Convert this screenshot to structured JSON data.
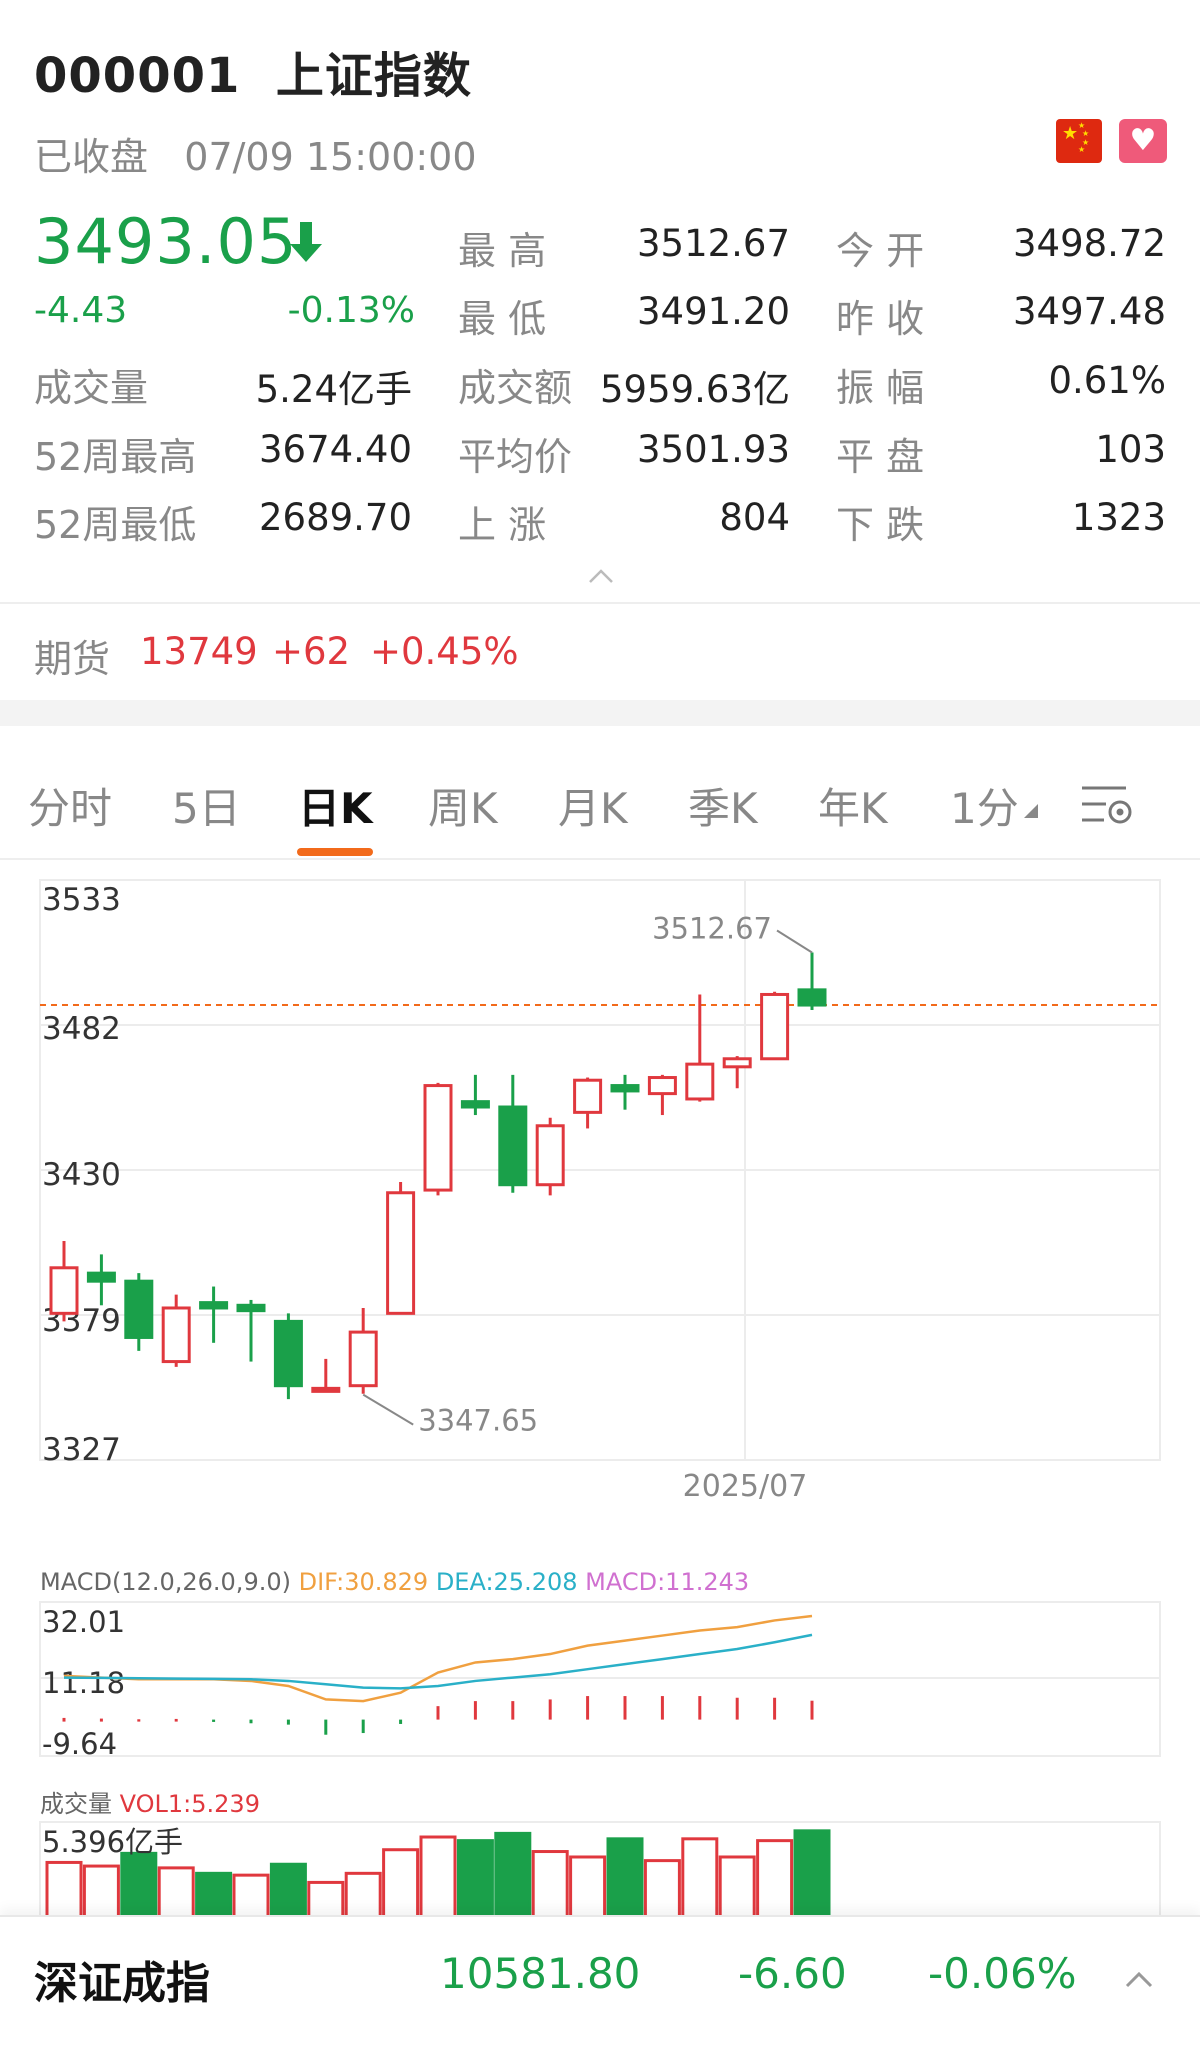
{
  "header": {
    "code": "000001",
    "name": "上证指数",
    "status": "已收盘",
    "datetime": "07/09 15:00:00"
  },
  "quote": {
    "price": "3493.05",
    "change": "-4.43",
    "change_pct": "-0.13%"
  },
  "stats": {
    "high_label": "最 高",
    "high": "3512.67",
    "open_label": "今 开",
    "open": "3498.72",
    "low_label": "最 低",
    "low": "3491.20",
    "prev_close_label": "昨 收",
    "prev_close": "3497.48",
    "volume_label": "成交量",
    "volume": "5.24亿手",
    "turnover_label": "成交额",
    "turnover": "5959.63亿",
    "amplitude_label": "振 幅",
    "amplitude": "0.61%",
    "w52_high_label": "52周最高",
    "w52_high": "3674.40",
    "avg_price_label": "平均价",
    "avg_price": "3501.93",
    "flat_label": "平 盘",
    "flat": "103",
    "w52_low_label": "52周最低",
    "w52_low": "2689.70",
    "up_label": "上 涨",
    "up": "804",
    "down_label": "下 跌",
    "down": "1323"
  },
  "futures": {
    "label": "期货",
    "value": "13749",
    "change": "+62",
    "change_pct": "+0.45%"
  },
  "tabs": [
    "分时",
    "5日",
    "日K",
    "周K",
    "月K",
    "季K",
    "年K",
    "1分"
  ],
  "active_tab": "日K",
  "colors": {
    "up": "#e0383e",
    "down": "#1aa04a",
    "accent": "#f26a1b",
    "dif": "#f0a040",
    "dea": "#2ab0c8",
    "macd": "#d070d0"
  },
  "chart_data": [
    {
      "type": "candlestick",
      "y_ticks": [
        "3533",
        "3482",
        "3430",
        "3379",
        "3327"
      ],
      "ylim": [
        3327,
        3533
      ],
      "x_label": "2025/07",
      "current_line": 3493.05,
      "annotations": [
        {
          "text": "3512.67",
          "index": 20,
          "value": 3512.67
        },
        {
          "text": "3347.65",
          "index": 8,
          "value": 3347.65
        }
      ],
      "candles": [
        {
          "o": 3378,
          "h": 3405,
          "l": 3375,
          "c": 3395
        },
        {
          "o": 3393,
          "h": 3400,
          "l": 3381,
          "c": 3390
        },
        {
          "o": 3390,
          "h": 3393,
          "l": 3364,
          "c": 3369
        },
        {
          "o": 3360,
          "h": 3385,
          "l": 3358,
          "c": 3380
        },
        {
          "o": 3382,
          "h": 3388,
          "l": 3367,
          "c": 3380
        },
        {
          "o": 3381,
          "h": 3383,
          "l": 3360,
          "c": 3379
        },
        {
          "o": 3375,
          "h": 3378,
          "l": 3346,
          "c": 3351
        },
        {
          "o": 3349,
          "h": 3361,
          "l": 3349,
          "c": 3350
        },
        {
          "o": 3351,
          "h": 3380,
          "l": 3348,
          "c": 3371
        },
        {
          "o": 3378,
          "h": 3427,
          "l": 3378,
          "c": 3423
        },
        {
          "o": 3424,
          "h": 3464,
          "l": 3422,
          "c": 3463
        },
        {
          "o": 3457,
          "h": 3467,
          "l": 3452,
          "c": 3455
        },
        {
          "o": 3455,
          "h": 3467,
          "l": 3423,
          "c": 3426
        },
        {
          "o": 3426,
          "h": 3451,
          "l": 3422,
          "c": 3448
        },
        {
          "o": 3453,
          "h": 3466,
          "l": 3447,
          "c": 3465
        },
        {
          "o": 3463,
          "h": 3467,
          "l": 3454,
          "c": 3461
        },
        {
          "o": 3460,
          "h": 3467,
          "l": 3452,
          "c": 3466
        },
        {
          "o": 3458,
          "h": 3497,
          "l": 3457,
          "c": 3471
        },
        {
          "o": 3470,
          "h": 3474,
          "l": 3462,
          "c": 3473
        },
        {
          "o": 3473,
          "h": 3498,
          "l": 3473,
          "c": 3497
        },
        {
          "o": 3498.72,
          "h": 3512.67,
          "l": 3491.2,
          "c": 3493.05
        }
      ]
    },
    {
      "type": "line",
      "title": "MACD(12.0,26.0,9.0)",
      "legend": {
        "dif": "DIF:30.829",
        "dea": "DEA:25.208",
        "macd": "MACD:11.243"
      },
      "y_ticks": [
        "32.01",
        "11.18",
        "-9.64"
      ],
      "ylim": [
        -9.64,
        32.01
      ],
      "series": [
        {
          "name": "DIF",
          "values": [
            13.0,
            12.5,
            12.0,
            12.0,
            12.0,
            11.5,
            10.0,
            6.0,
            5.5,
            8.0,
            14.0,
            17.0,
            18.0,
            19.5,
            22.0,
            23.5,
            25.0,
            26.5,
            27.5,
            29.5,
            30.829
          ]
        },
        {
          "name": "DEA",
          "values": [
            12.5,
            12.4,
            12.3,
            12.2,
            12.1,
            12.0,
            11.5,
            10.5,
            9.5,
            9.3,
            10.0,
            11.5,
            12.5,
            13.5,
            15.0,
            16.5,
            18.0,
            19.5,
            21.0,
            23.0,
            25.208
          ]
        },
        {
          "name": "MACD",
          "values": [
            0.5,
            0.3,
            0.1,
            0.2,
            -0.1,
            -0.5,
            -1.5,
            -4.5,
            -4.0,
            -1.3,
            4.0,
            5.5,
            5.5,
            6.0,
            7.0,
            7.0,
            7.0,
            7.0,
            6.5,
            6.5,
            5.621
          ]
        }
      ]
    },
    {
      "type": "bar",
      "title": "成交量",
      "legend": "VOL1:5.239",
      "y_tick": "5.396亿手",
      "ylim": [
        0,
        5.396
      ],
      "values": [
        3.5,
        3.3,
        4.0,
        3.2,
        2.9,
        2.8,
        3.4,
        2.4,
        2.9,
        4.2,
        4.9,
        4.7,
        5.1,
        4.1,
        3.8,
        4.8,
        3.6,
        4.8,
        3.8,
        4.7,
        5.24
      ],
      "up": [
        true,
        true,
        false,
        true,
        false,
        true,
        false,
        true,
        true,
        true,
        true,
        false,
        false,
        true,
        true,
        false,
        true,
        true,
        true,
        true,
        false
      ]
    }
  ],
  "bottom_bar": {
    "name": "深证成指",
    "value": "10581.80",
    "change": "-6.60",
    "change_pct": "-0.06%"
  }
}
